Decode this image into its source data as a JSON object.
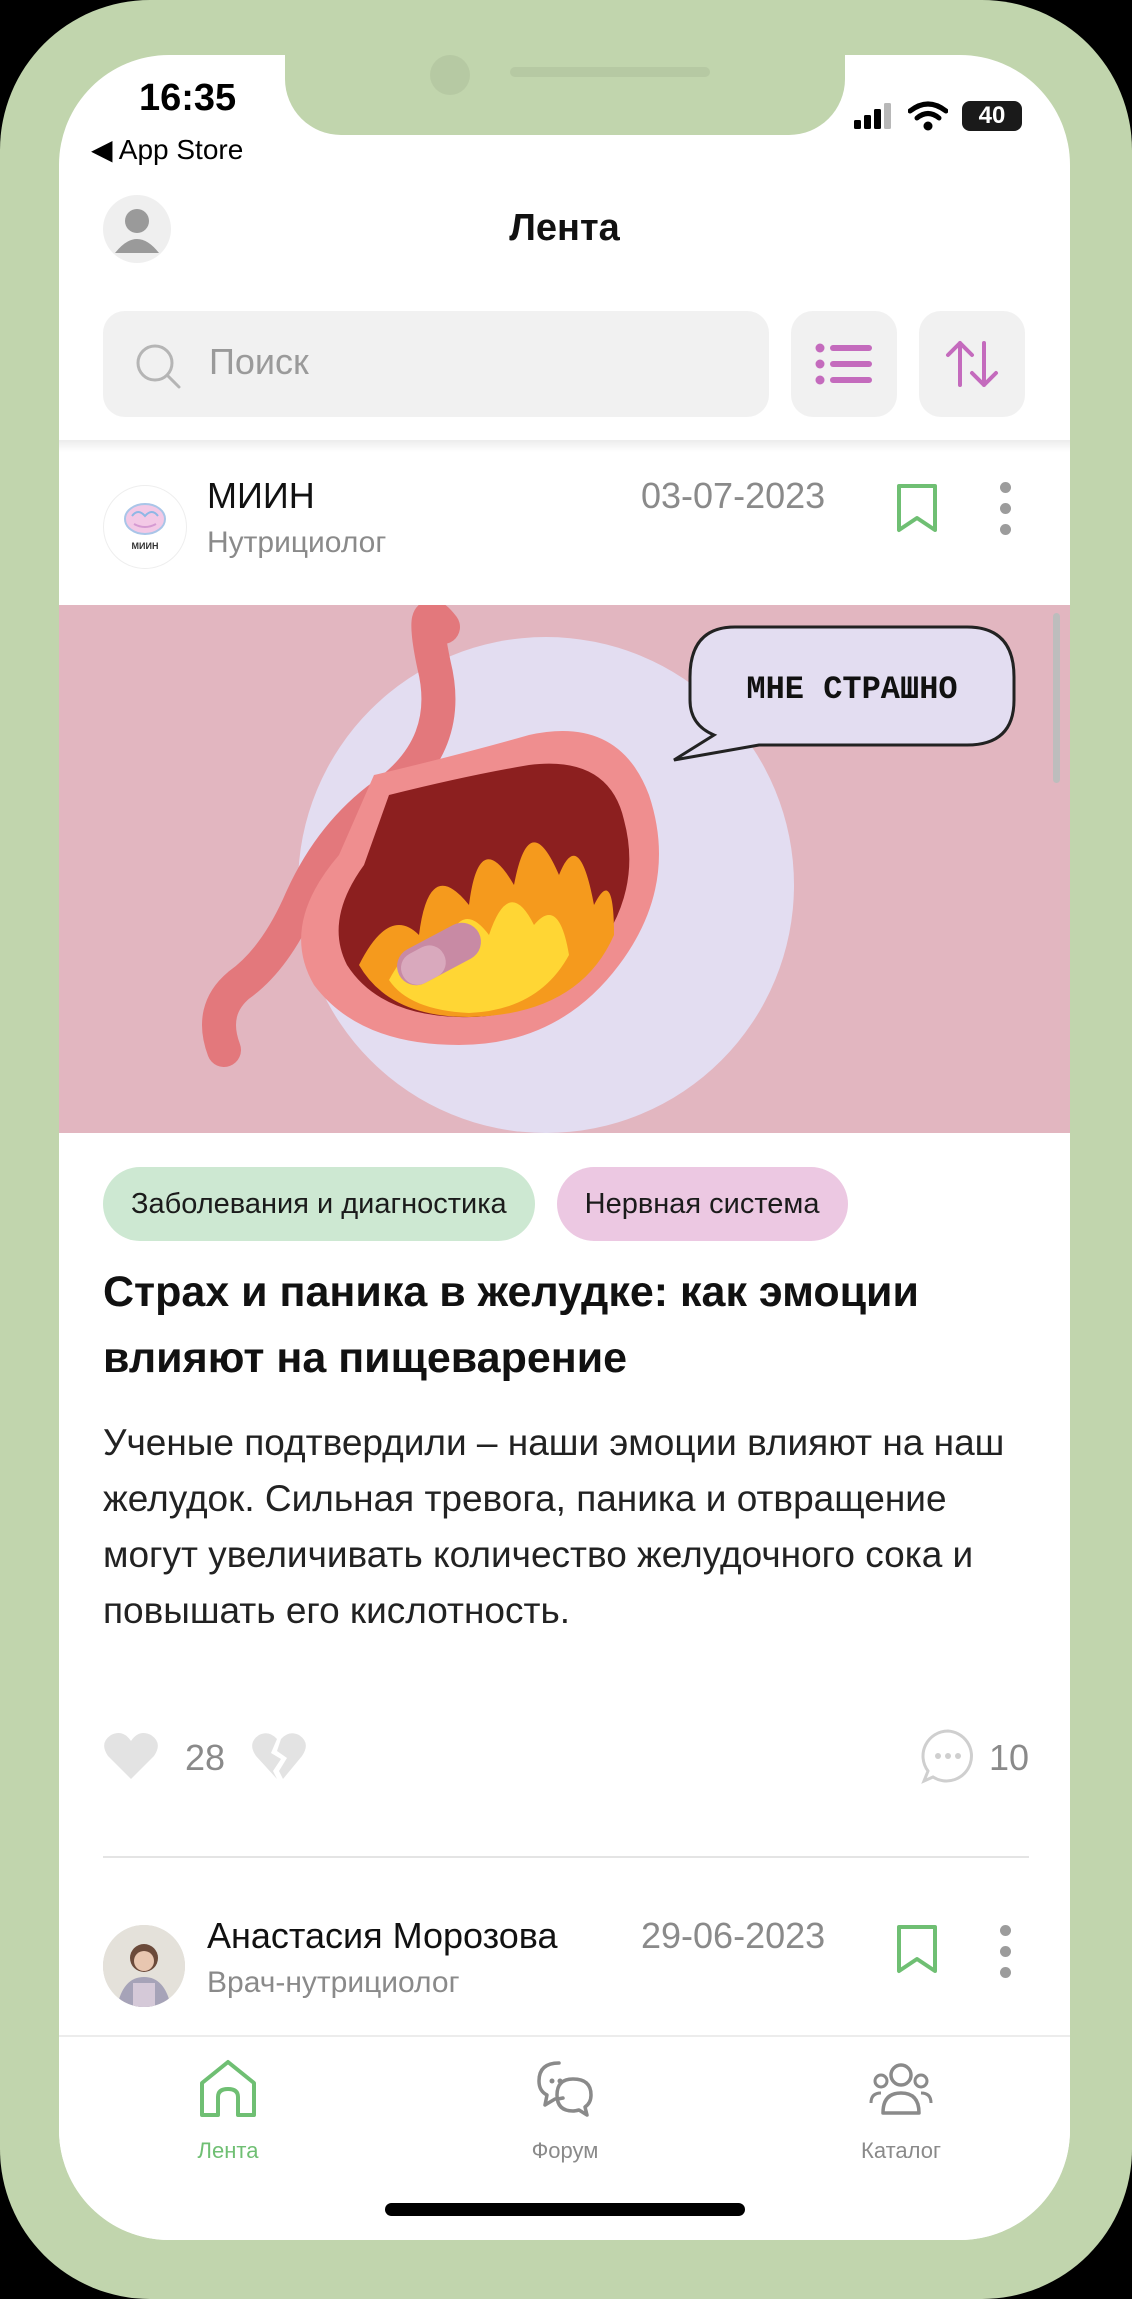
{
  "status_bar": {
    "time": "16:35",
    "back_app": "◀ App Store",
    "battery": "40"
  },
  "header": {
    "title": "Лента"
  },
  "search": {
    "placeholder": "Поиск"
  },
  "colors": {
    "accent_green": "#6fbf73",
    "accent_pink": "#c46bbd",
    "frame": "#c1d5ad"
  },
  "posts": [
    {
      "author": "МИИН",
      "role": "Нутрициолог",
      "date": "03-07-2023",
      "logo_text": "МИИН",
      "image_caption": "МНЕ СТРАШНО",
      "tags": [
        "Заболевания и диагностика",
        "Нервная система"
      ],
      "title": "Страх и паника в желудке: как эмоции влияют на пищеварение",
      "text": "Ученые подтвердили – наши эмоции влияют на наш желудок. Сильная тревога, паника и отвращение могут увеличивать количество желудочного сока и повышать его кислотность.",
      "likes": "28",
      "comments": "10"
    },
    {
      "author": "Анастасия Морозова",
      "role": "Врач-нутрициолог",
      "date": "29-06-2023"
    }
  ],
  "tabbar": [
    {
      "label": "Лента",
      "icon": "home-icon",
      "active": true
    },
    {
      "label": "Форум",
      "icon": "chat-bubbles-icon",
      "active": false
    },
    {
      "label": "Каталог",
      "icon": "people-icon",
      "active": false
    }
  ]
}
